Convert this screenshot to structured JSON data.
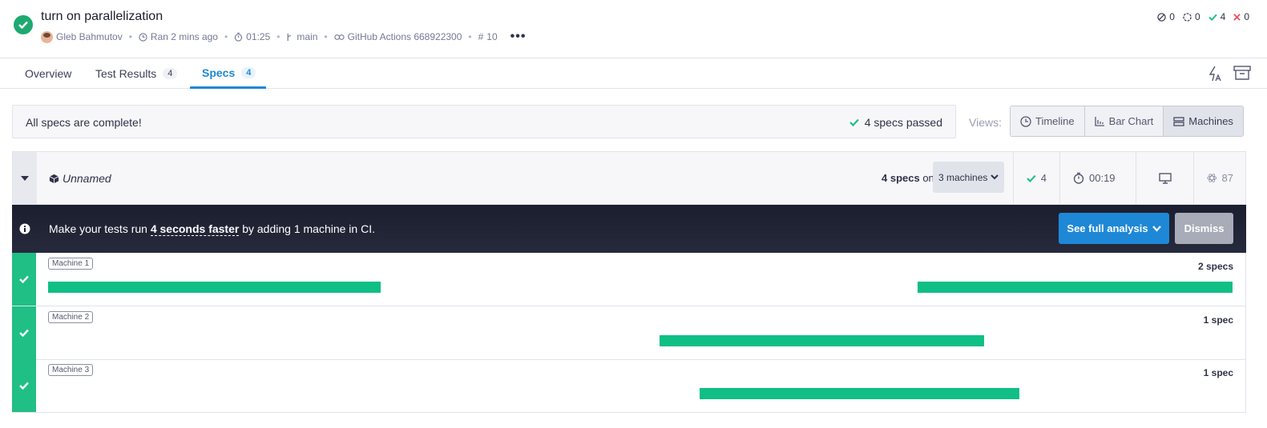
{
  "run": {
    "title": "turn on parallelization",
    "author": "Gleb Bahmutov",
    "ran": "Ran 2 mins ago",
    "duration": "01:25",
    "branch": "main",
    "ci": "GitHub Actions 668922300",
    "number": "10",
    "more": "•••"
  },
  "counts": {
    "skipped": "0",
    "pending": "0",
    "passed": "4",
    "failed": "0"
  },
  "tabs": [
    {
      "label": "Overview",
      "badge": ""
    },
    {
      "label": "Test Results",
      "badge": "4"
    },
    {
      "label": "Specs",
      "badge": "4"
    }
  ],
  "status": {
    "message": "All specs are complete!",
    "passed": "4 specs passed"
  },
  "views": {
    "label": "Views:",
    "options": [
      "Timeline",
      "Bar Chart",
      "Machines"
    ],
    "selected": "Machines"
  },
  "group": {
    "name": "Unnamed",
    "specs_count": "4 specs",
    "on_word": "on",
    "machines": "3 machines",
    "passed": "4",
    "duration": "00:19",
    "browser_count": "87"
  },
  "banner": {
    "prefix": "Make your tests run",
    "highlight": "4 seconds faster",
    "suffix": "by adding 1 machine in CI.",
    "analysis": "See full analysis",
    "dismiss": "Dismiss"
  },
  "machines": [
    {
      "label": "Machine 1",
      "specs": "2 specs",
      "spans": [
        [
          0.0,
          0.281
        ],
        [
          0.734,
          1.0
        ]
      ]
    },
    {
      "label": "Machine 2",
      "specs": "1 spec",
      "spans": [
        [
          0.516,
          0.79
        ]
      ]
    },
    {
      "label": "Machine 3",
      "specs": "1 spec",
      "spans": [
        [
          0.55,
          0.82
        ]
      ]
    }
  ],
  "colors": {
    "accent": "#1e88d6",
    "success": "#1fbf85",
    "failed": "#e94f5f",
    "banner": "#1b1e2e"
  }
}
